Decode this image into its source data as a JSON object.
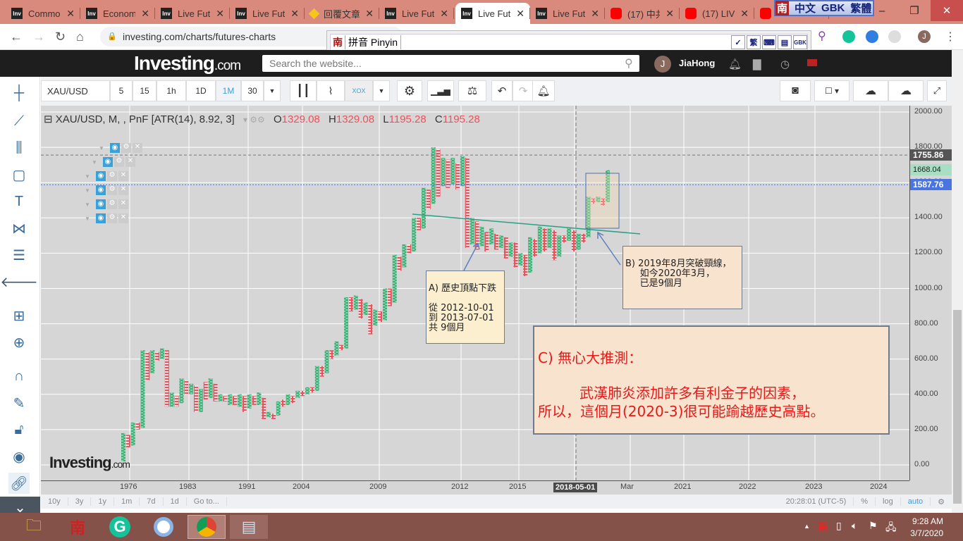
{
  "tabs": [
    {
      "title": "Commo",
      "icon": "Inv"
    },
    {
      "title": "Econom",
      "icon": "Inv"
    },
    {
      "title": "Live Fut",
      "icon": "Inv"
    },
    {
      "title": "Live Fut",
      "icon": "Inv"
    },
    {
      "title": "回覆文章",
      "icon": "gem"
    },
    {
      "title": "Live Fut",
      "icon": "Inv"
    },
    {
      "title": "Live Fut",
      "icon": "Inv",
      "active": true
    },
    {
      "title": "Live Fut",
      "icon": "Inv"
    },
    {
      "title": "(17) 中共",
      "icon": "yt"
    },
    {
      "title": "(17) LIVE",
      "icon": "yt"
    },
    {
      "title": "",
      "icon": "yt"
    }
  ],
  "ime_status": {
    "logo": "南",
    "mode": "中文",
    "encoding": "GBK",
    "script": "繁體"
  },
  "url": "investing.com/charts/futures-charts",
  "pinyin": {
    "logo": "南",
    "label": "拼音 Pinyin",
    "trad": "繁",
    "gbk": "GBK"
  },
  "header": {
    "logo_main": "Investing",
    "logo_suffix": ".com",
    "search_placeholder": "Search the website...",
    "avatar_letter": "J",
    "username": "JiaHong"
  },
  "toolbar": {
    "symbol": "XAU/USD",
    "intervals": [
      "5",
      "15",
      "1h",
      "1D",
      "1M",
      "30"
    ],
    "active_interval": "1M"
  },
  "legend": {
    "title": "XAU/USD, M, , PnF [ATR(14), 8.92, 3]",
    "o_label": "O",
    "o": "1329.08",
    "h_label": "H",
    "h": "1329.08",
    "l_label": "L",
    "l": "1195.28",
    "c_label": "C",
    "c": "1195.28"
  },
  "price_axis": [
    "2000.00",
    "1800.00",
    "1600.00",
    "1400.00",
    "1200.00",
    "1000.00",
    "800.00",
    "600.00",
    "400.00",
    "200.00",
    "0.00"
  ],
  "price_labels": {
    "dashed_high": "1755.86",
    "current": "1668.04",
    "line": "1587.76"
  },
  "time_axis": [
    "1976",
    "1983",
    "1991",
    "2004",
    "2009",
    "2012",
    "2015",
    "2018-05-01",
    "Mar",
    "2021",
    "2022",
    "2023",
    "2024"
  ],
  "watermark": {
    "main": "Investing",
    "suffix": ".com"
  },
  "annotations": {
    "a": "A) 歷史頂點下跌\n\n從 2012-10-01\n到 2013-07-01\n共 9個月",
    "b": "B) 2019年8月突破頸線，\n     如今2020年3月，\n     已是9個月",
    "c_title": "C)  無心大推測：",
    "c_line1": "武漢肺炎添加許多有利金子的因素，",
    "c_line2": "所以，這個月(2020-3)很可能踰越歷史高點。"
  },
  "bottom_bar": {
    "ranges": [
      "10y",
      "3y",
      "1y",
      "1m",
      "7d",
      "1d",
      "Go to..."
    ],
    "time": "20:28:01 (UTC-5)",
    "pct": "%",
    "log": "log",
    "auto": "auto"
  },
  "taskbar": {
    "time": "9:28 AM",
    "date": "3/7/2020"
  },
  "colors": {
    "up": "#3fb07a",
    "down": "#f0505a",
    "tab_bg": "#d98a7c",
    "taskbar": "#85524a"
  },
  "chart_data": {
    "type": "point-and-figure",
    "ylim": [
      0,
      2000
    ],
    "columns": [
      [
        "X",
        20,
        180
      ],
      [
        "O",
        100,
        170
      ],
      [
        "X",
        110,
        240
      ],
      [
        "O",
        200,
        240
      ],
      [
        "X",
        210,
        650
      ],
      [
        "O",
        480,
        640
      ],
      [
        "X",
        520,
        650
      ],
      [
        "O",
        590,
        640
      ],
      [
        "X",
        600,
        660
      ],
      [
        "O",
        330,
        650
      ],
      [
        "X",
        330,
        410
      ],
      [
        "O",
        330,
        390
      ],
      [
        "X",
        350,
        490
      ],
      [
        "O",
        400,
        480
      ],
      [
        "X",
        400,
        460
      ],
      [
        "O",
        300,
        450
      ],
      [
        "X",
        300,
        430
      ],
      [
        "O",
        370,
        470
      ],
      [
        "X",
        380,
        490
      ],
      [
        "O",
        360,
        460
      ],
      [
        "X",
        360,
        400
      ],
      [
        "O",
        360,
        390
      ],
      [
        "X",
        340,
        400
      ],
      [
        "O",
        340,
        390
      ],
      [
        "X",
        330,
        400
      ],
      [
        "O",
        300,
        390
      ],
      [
        "X",
        320,
        400
      ],
      [
        "O",
        340,
        390
      ],
      [
        "X",
        340,
        410
      ],
      [
        "O",
        260,
        380
      ],
      [
        "X",
        270,
        300
      ],
      [
        "O",
        260,
        290
      ],
      [
        "X",
        280,
        360
      ],
      [
        "O",
        330,
        370
      ],
      [
        "X",
        340,
        400
      ],
      [
        "O",
        350,
        390
      ],
      [
        "X",
        380,
        420
      ],
      [
        "O",
        390,
        420
      ],
      [
        "X",
        400,
        440
      ],
      [
        "O",
        410,
        440
      ],
      [
        "X",
        420,
        560
      ],
      [
        "O",
        500,
        560
      ],
      [
        "X",
        520,
        650
      ],
      [
        "O",
        600,
        650
      ],
      [
        "X",
        620,
        700
      ],
      [
        "O",
        650,
        680
      ],
      [
        "X",
        660,
        950
      ],
      [
        "O",
        870,
        950
      ],
      [
        "X",
        880,
        960
      ],
      [
        "O",
        830,
        940
      ],
      [
        "X",
        850,
        920
      ],
      [
        "O",
        740,
        910
      ],
      [
        "X",
        790,
        880
      ],
      [
        "O",
        810,
        870
      ],
      [
        "X",
        820,
        1000
      ],
      [
        "O",
        900,
        1000
      ],
      [
        "X",
        920,
        1190
      ],
      [
        "O",
        1100,
        1180
      ],
      [
        "X",
        1120,
        1250
      ],
      [
        "O",
        1200,
        1250
      ],
      [
        "X",
        1210,
        1400
      ],
      [
        "O",
        1330,
        1400
      ],
      [
        "X",
        1340,
        1570
      ],
      [
        "O",
        1450,
        1560
      ],
      [
        "X",
        1480,
        1800
      ],
      [
        "O",
        1520,
        1790
      ],
      [
        "X",
        1580,
        1740
      ],
      [
        "O",
        1570,
        1730
      ],
      [
        "X",
        1590,
        1740
      ],
      [
        "O",
        1560,
        1710
      ],
      [
        "X",
        1580,
        1750
      ],
      [
        "O",
        1230,
        1740
      ],
      [
        "X",
        1250,
        1400
      ],
      [
        "O",
        1220,
        1380
      ],
      [
        "X",
        1240,
        1350
      ],
      [
        "O",
        1210,
        1320
      ],
      [
        "X",
        1250,
        1340
      ],
      [
        "O",
        1220,
        1310
      ],
      [
        "X",
        1230,
        1300
      ],
      [
        "O",
        1170,
        1290
      ],
      [
        "X",
        1180,
        1260
      ],
      [
        "O",
        1120,
        1260
      ],
      [
        "X",
        1130,
        1200
      ],
      [
        "O",
        1070,
        1190
      ],
      [
        "X",
        1090,
        1290
      ],
      [
        "O",
        1180,
        1280
      ],
      [
        "X",
        1200,
        1350
      ],
      [
        "O",
        1210,
        1340
      ],
      [
        "X",
        1230,
        1340
      ],
      [
        "O",
        1160,
        1330
      ],
      [
        "X",
        1180,
        1300
      ],
      [
        "O",
        1260,
        1300
      ],
      [
        "X",
        1270,
        1340
      ],
      [
        "O",
        1210,
        1330
      ],
      [
        "X",
        1220,
        1310
      ],
      [
        "O",
        1260,
        1310
      ],
      [
        "X",
        1290,
        1520
      ],
      [
        "O",
        1480,
        1510
      ],
      [
        "X",
        1490,
        1520
      ],
      [
        "O",
        1470,
        1510
      ],
      [
        "X",
        1490,
        1670
      ]
    ]
  }
}
